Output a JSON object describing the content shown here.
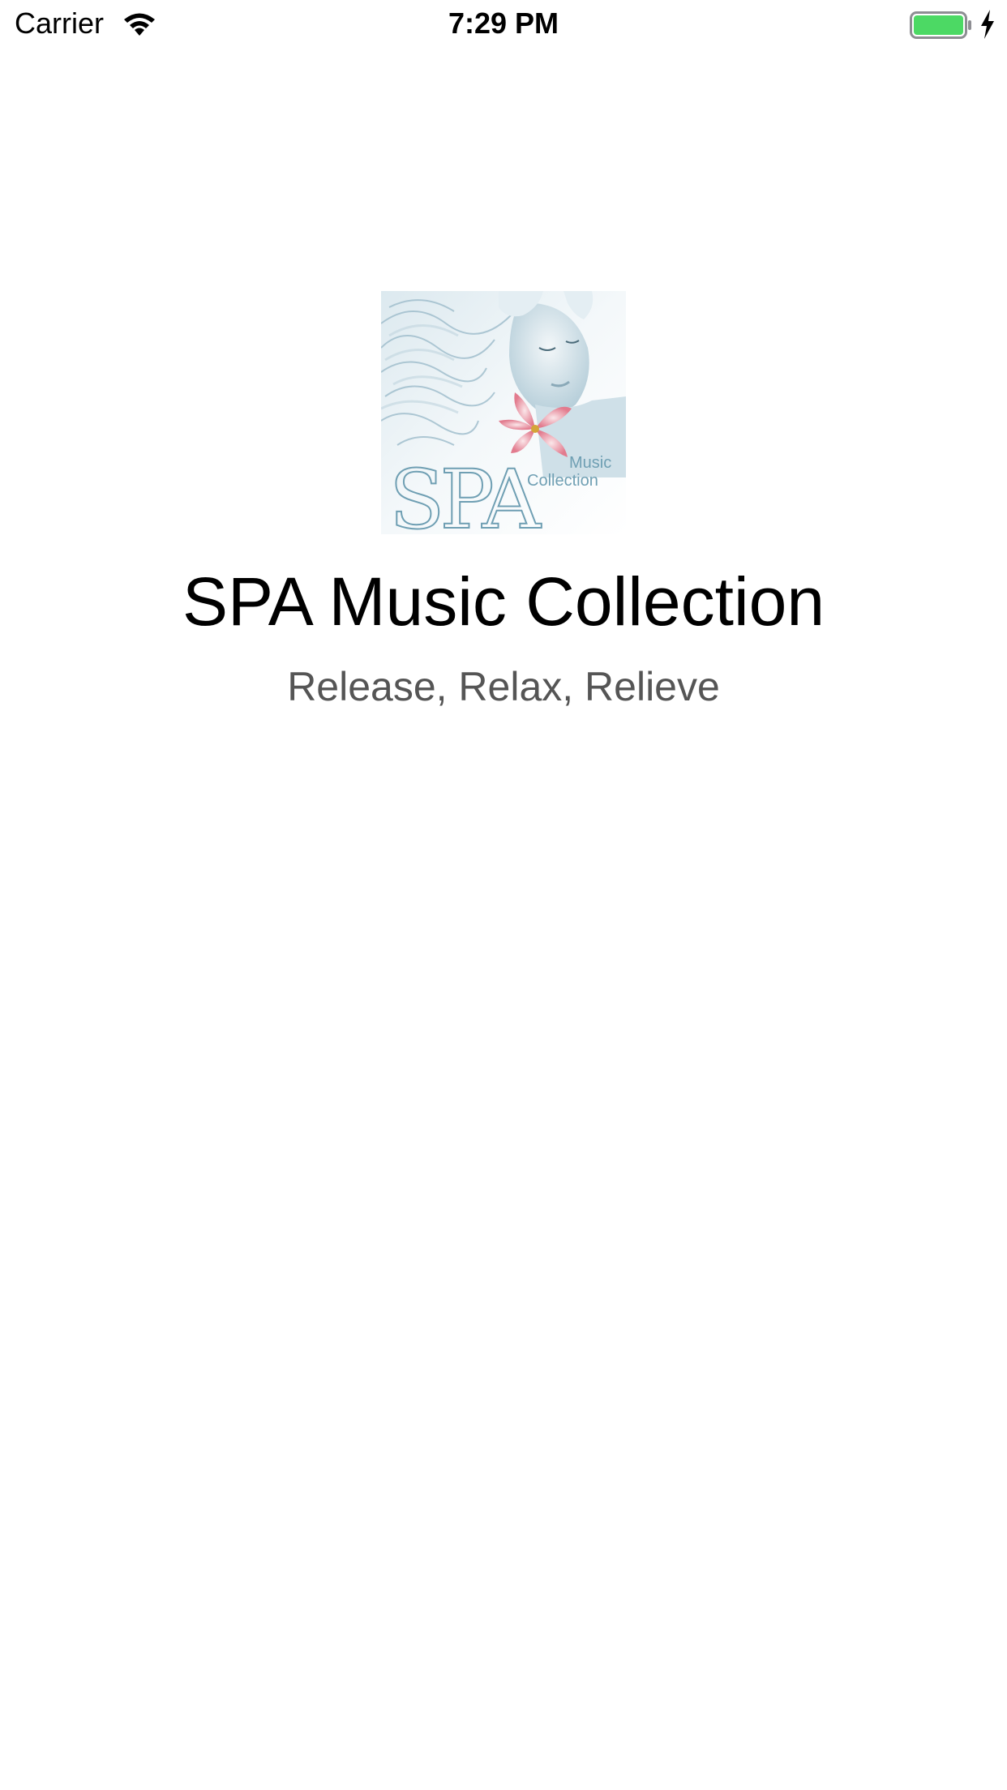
{
  "status_bar": {
    "carrier": "Carrier",
    "time": "7:29 PM",
    "battery_level": 1.0,
    "battery_color": "#4cd964",
    "charging": true
  },
  "album_art": {
    "logo_text": "SPA",
    "logo_subtext_line1": "Music",
    "logo_subtext_line2": "Collection",
    "tint_color": "#6f9fb3"
  },
  "main": {
    "title": "SPA Music Collection",
    "subtitle": "Release, Relax, Relieve"
  }
}
